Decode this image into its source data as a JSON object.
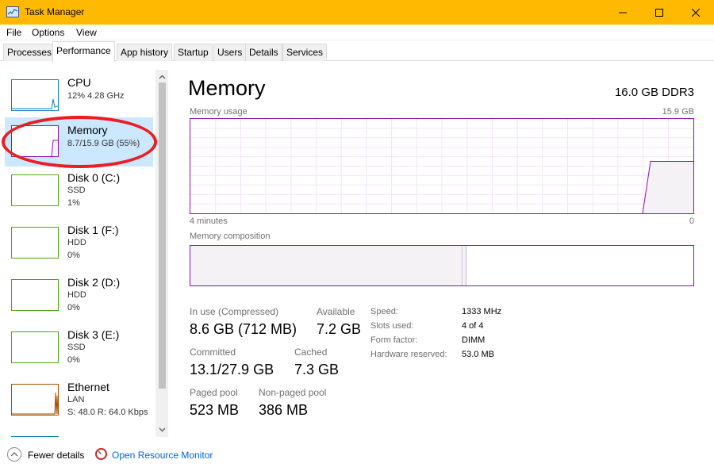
{
  "window": {
    "title": "Task Manager",
    "accent_color": "#ffb900",
    "controls": [
      "minimize-icon",
      "maximize-icon",
      "close-icon"
    ]
  },
  "menu": {
    "file": "File",
    "options": "Options",
    "view": "View"
  },
  "tabs": [
    {
      "label": "Processes"
    },
    {
      "label": "Performance",
      "active": true
    },
    {
      "label": "App history"
    },
    {
      "label": "Startup"
    },
    {
      "label": "Users"
    },
    {
      "label": "Details"
    },
    {
      "label": "Services"
    }
  ],
  "sidebar": {
    "items": [
      {
        "name": "CPU",
        "lines": [
          "12% 4.28 GHz"
        ],
        "color": "#117dbb"
      },
      {
        "name": "Memory",
        "lines": [
          "8.7/15.9 GB (55%)"
        ],
        "color": "#8b12ae",
        "selected": true
      },
      {
        "name": "Disk 0 (C:)",
        "lines": [
          "SSD",
          "1%"
        ],
        "color": "#4da60c"
      },
      {
        "name": "Disk 1 (F:)",
        "lines": [
          "HDD",
          "0%"
        ],
        "color": "#4da60c"
      },
      {
        "name": "Disk 2 (D:)",
        "lines": [
          "HDD",
          "0%"
        ],
        "color": "#4da60c"
      },
      {
        "name": "Disk 3 (E:)",
        "lines": [
          "SSD",
          "0%"
        ],
        "color": "#4da60c"
      },
      {
        "name": "Ethernet",
        "lines": [
          "LAN",
          "S: 48.0  R: 64.0 Kbps"
        ],
        "color": "#a74f01"
      }
    ],
    "highlight_color": "#ed1c24"
  },
  "main": {
    "title": "Memory",
    "spec": "16.0 GB DDR3",
    "usage_label": "Memory usage",
    "usage_max": "15.9 GB",
    "time_left": "4 minutes",
    "time_right": "0",
    "composition_label": "Memory composition",
    "usage_fraction": 0.55,
    "stats": {
      "in_use_label": "In use (Compressed)",
      "in_use_value": "8.6 GB (712 MB)",
      "available_label": "Available",
      "available_value": "7.2 GB",
      "committed_label": "Committed",
      "committed_value": "13.1/27.9 GB",
      "cached_label": "Cached",
      "cached_value": "7.3 GB",
      "paged_label": "Paged pool",
      "paged_value": "523 MB",
      "nonpaged_label": "Non-paged pool",
      "nonpaged_value": "386 MB"
    },
    "specs": [
      {
        "label": "Speed:",
        "value": "1333 MHz"
      },
      {
        "label": "Slots used:",
        "value": "4 of 4"
      },
      {
        "label": "Form factor:",
        "value": "DIMM"
      },
      {
        "label": "Hardware reserved:",
        "value": "53.0 MB"
      }
    ]
  },
  "footer": {
    "fewer_details": "Fewer details",
    "open_resource_monitor": "Open Resource Monitor"
  }
}
